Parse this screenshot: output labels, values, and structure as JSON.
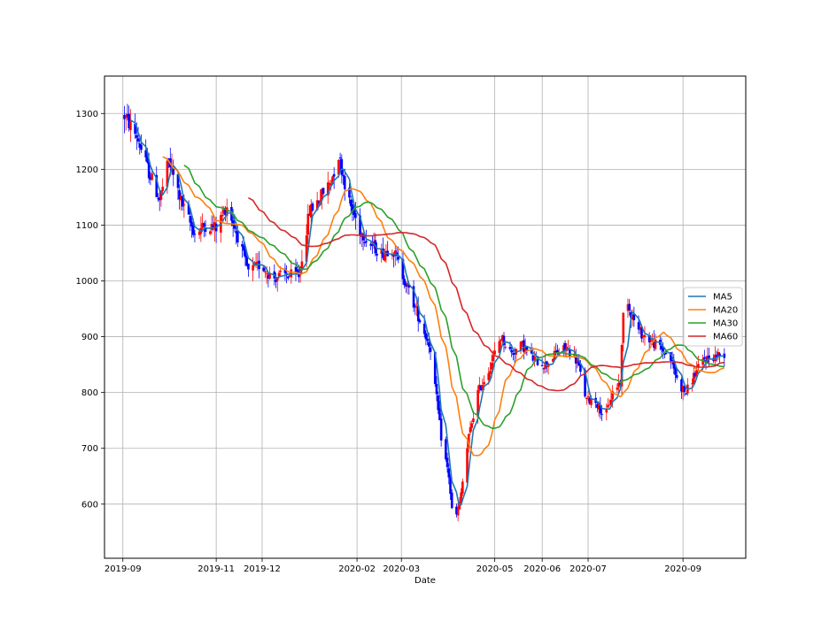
{
  "chart_data": {
    "type": "candlestick",
    "xlabel": "Date",
    "ylabel": "",
    "ylim": [
      503,
      1367
    ],
    "grid": true,
    "legend_position": "center-right",
    "x_ticks": [
      "2019-09",
      "2019-11",
      "2019-12",
      "2020-02",
      "2020-03",
      "2020-05",
      "2020-06",
      "2020-07",
      "2020-09"
    ],
    "y_ticks": [
      600,
      700,
      800,
      900,
      1000,
      1100,
      1200,
      1300
    ],
    "candle_colors": {
      "up": "#ff0000",
      "down": "#0000ff"
    },
    "close_anchors": [
      [
        "2019-09-01",
        1300
      ],
      [
        "2019-09-10",
        1260
      ],
      [
        "2019-09-18",
        1195
      ],
      [
        "2019-09-25",
        1145
      ],
      [
        "2019-10-01",
        1215
      ],
      [
        "2019-10-10",
        1135
      ],
      [
        "2019-10-18",
        1085
      ],
      [
        "2019-10-25",
        1100
      ],
      [
        "2019-11-01",
        1095
      ],
      [
        "2019-11-08",
        1135
      ],
      [
        "2019-11-15",
        1080
      ],
      [
        "2019-11-22",
        1015
      ],
      [
        "2019-11-30",
        1030
      ],
      [
        "2019-12-08",
        1005
      ],
      [
        "2019-12-15",
        1010
      ],
      [
        "2019-12-25",
        1010
      ],
      [
        "2020-01-01",
        1125
      ],
      [
        "2020-01-08",
        1150
      ],
      [
        "2020-01-15",
        1180
      ],
      [
        "2020-01-20",
        1225
      ],
      [
        "2020-01-27",
        1140
      ],
      [
        "2020-02-03",
        1090
      ],
      [
        "2020-02-10",
        1065
      ],
      [
        "2020-02-17",
        1050
      ],
      [
        "2020-02-24",
        1060
      ],
      [
        "2020-03-02",
        1010
      ],
      [
        "2020-03-09",
        960
      ],
      [
        "2020-03-15",
        915
      ],
      [
        "2020-03-20",
        880
      ],
      [
        "2020-03-27",
        720
      ],
      [
        "2020-04-01",
        650
      ],
      [
        "2020-04-04",
        560
      ],
      [
        "2020-04-08",
        600
      ],
      [
        "2020-04-14",
        720
      ],
      [
        "2020-04-20",
        800
      ],
      [
        "2020-04-27",
        840
      ],
      [
        "2020-05-05",
        900
      ],
      [
        "2020-05-12",
        870
      ],
      [
        "2020-05-19",
        885
      ],
      [
        "2020-05-26",
        860
      ],
      [
        "2020-06-03",
        850
      ],
      [
        "2020-06-10",
        870
      ],
      [
        "2020-06-17",
        880
      ],
      [
        "2020-06-24",
        855
      ],
      [
        "2020-06-30",
        785
      ],
      [
        "2020-07-05",
        790
      ],
      [
        "2020-07-12",
        755
      ],
      [
        "2020-07-17",
        800
      ],
      [
        "2020-07-22",
        820
      ],
      [
        "2020-07-25",
        1000
      ],
      [
        "2020-07-28",
        950
      ],
      [
        "2020-08-03",
        910
      ],
      [
        "2020-08-10",
        895
      ],
      [
        "2020-08-17",
        880
      ],
      [
        "2020-08-24",
        860
      ],
      [
        "2020-08-29",
        815
      ],
      [
        "2020-09-03",
        800
      ],
      [
        "2020-09-08",
        830
      ],
      [
        "2020-09-15",
        860
      ],
      [
        "2020-09-22",
        865
      ],
      [
        "2020-09-28",
        870
      ]
    ],
    "series": [
      {
        "name": "MA5",
        "color": "#1f77b4",
        "window": 5
      },
      {
        "name": "MA20",
        "color": "#ff7f0e",
        "window": 20
      },
      {
        "name": "MA30",
        "color": "#2ca02c",
        "window": 30
      },
      {
        "name": "MA60",
        "color": "#d62728",
        "window": 60
      }
    ]
  }
}
